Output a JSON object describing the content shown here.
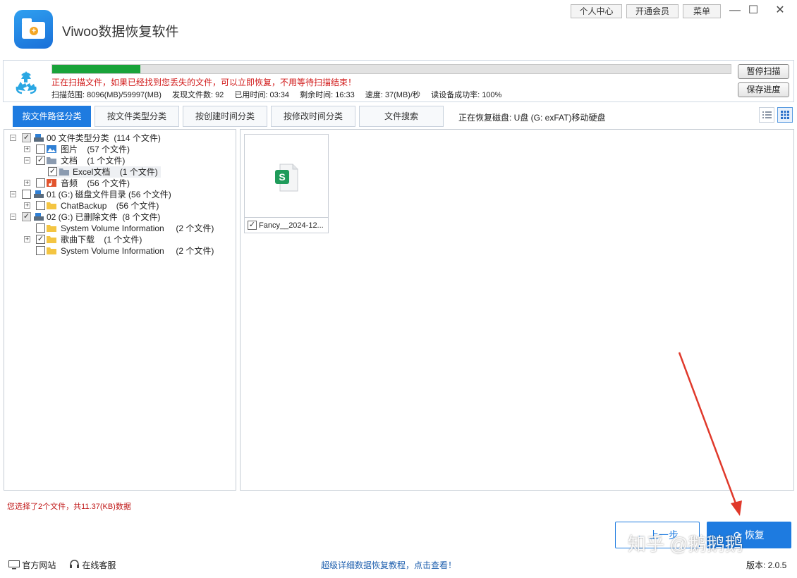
{
  "app": {
    "title": "Viwoo数据恢复软件"
  },
  "top_buttons": {
    "personal": "个人中心",
    "vip": "开通会员",
    "menu": "菜单"
  },
  "window_controls": {
    "minimize": "—",
    "maximize": "☐",
    "close": "✕"
  },
  "scan": {
    "progress_fraction": 0.13,
    "progress_color": "#19a33a",
    "message": "正在扫描文件，如果已经找到您丢失的文件，可以立即恢复，不用等待扫描结束！",
    "stats": {
      "range": "扫描范围: 8096(MB)/59997(MB)",
      "found": "发现文件数: 92",
      "elapsed": "已用时间: 03:34",
      "remaining": "剩余时间: 16:33",
      "speed": "速度: 37(MB)/秒",
      "read_rate": "读设备成功率: 100%"
    },
    "pause_button": "暂停扫描",
    "save_button": "保存进度"
  },
  "tabs": [
    "按文件路径分类",
    "按文件类型分类",
    "按创建时间分类",
    "按修改时间分类",
    "文件搜索"
  ],
  "disk_status": "正在恢复磁盘: U盘 (G: exFAT)移动硬盘",
  "tree": [
    {
      "label": "00 文件类型分类",
      "count": "(114 个文件)"
    },
    {
      "label": "图片",
      "count": "(57 个文件)"
    },
    {
      "label": "文档",
      "count": "(1 个文件)"
    },
    {
      "label": "Excel文档",
      "count": "(1 个文件)"
    },
    {
      "label": "音频",
      "count": "(56 个文件)"
    },
    {
      "label": "01 (G:) 磁盘文件目录",
      "count": "(56 个文件)"
    },
    {
      "label": "ChatBackup",
      "count": "(56 个文件)"
    },
    {
      "label": "02 (G:) 已删除文件",
      "count": "(8 个文件)"
    },
    {
      "label": "System Volume Information",
      "count": "(2 个文件)"
    },
    {
      "label": "歌曲下载",
      "count": "(1 个文件)"
    },
    {
      "label": "System Volume Information",
      "count": "(2 个文件)"
    }
  ],
  "file": {
    "name": "Fancy__2024-12...",
    "icon_letter": "S",
    "icon_color": "#1f9b5a"
  },
  "selection_status": "您选择了2个文件，共11.37(KB)数据",
  "buttons": {
    "prev": "上一步",
    "recover": "恢复"
  },
  "footer": {
    "website": "官方网站",
    "support": "在线客服",
    "tutorial": "超级详细数据恢复教程，点击查看！",
    "version": "版本: 2.0.5"
  },
  "watermark": "知乎 @鹅鹅鹅"
}
